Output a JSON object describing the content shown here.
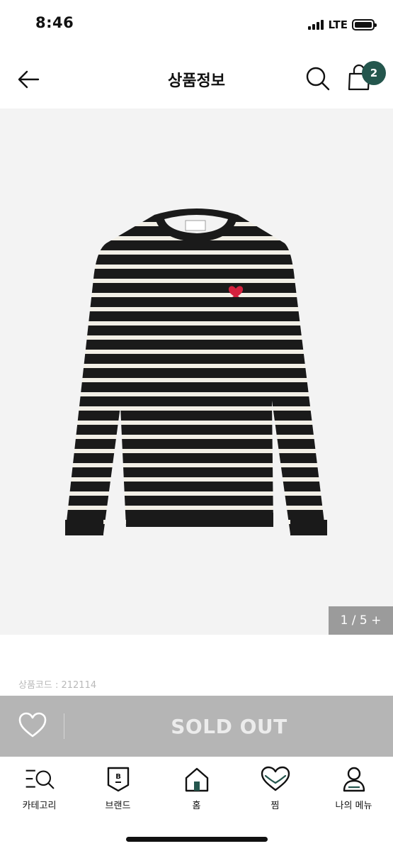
{
  "status": {
    "time": "8:46",
    "network": "LTE"
  },
  "header": {
    "title": "상품정보",
    "cart_count": "2"
  },
  "gallery": {
    "counter": "1 / 5 +"
  },
  "product": {
    "code": "상품코드 : 212114"
  },
  "action": {
    "soldout_label": "SOLD OUT"
  },
  "nav": {
    "items": [
      {
        "label": "카테고리",
        "icon": "category-search-icon"
      },
      {
        "label": "브랜드",
        "icon": "brand-icon"
      },
      {
        "label": "홈",
        "icon": "home-icon"
      },
      {
        "label": "찜",
        "icon": "heart-icon"
      },
      {
        "label": "나의 메뉴",
        "icon": "person-icon"
      }
    ]
  },
  "colors": {
    "accent": "#24564d",
    "soldout_bg": "#b5b5b5",
    "image_bg": "#f3f3f3"
  }
}
